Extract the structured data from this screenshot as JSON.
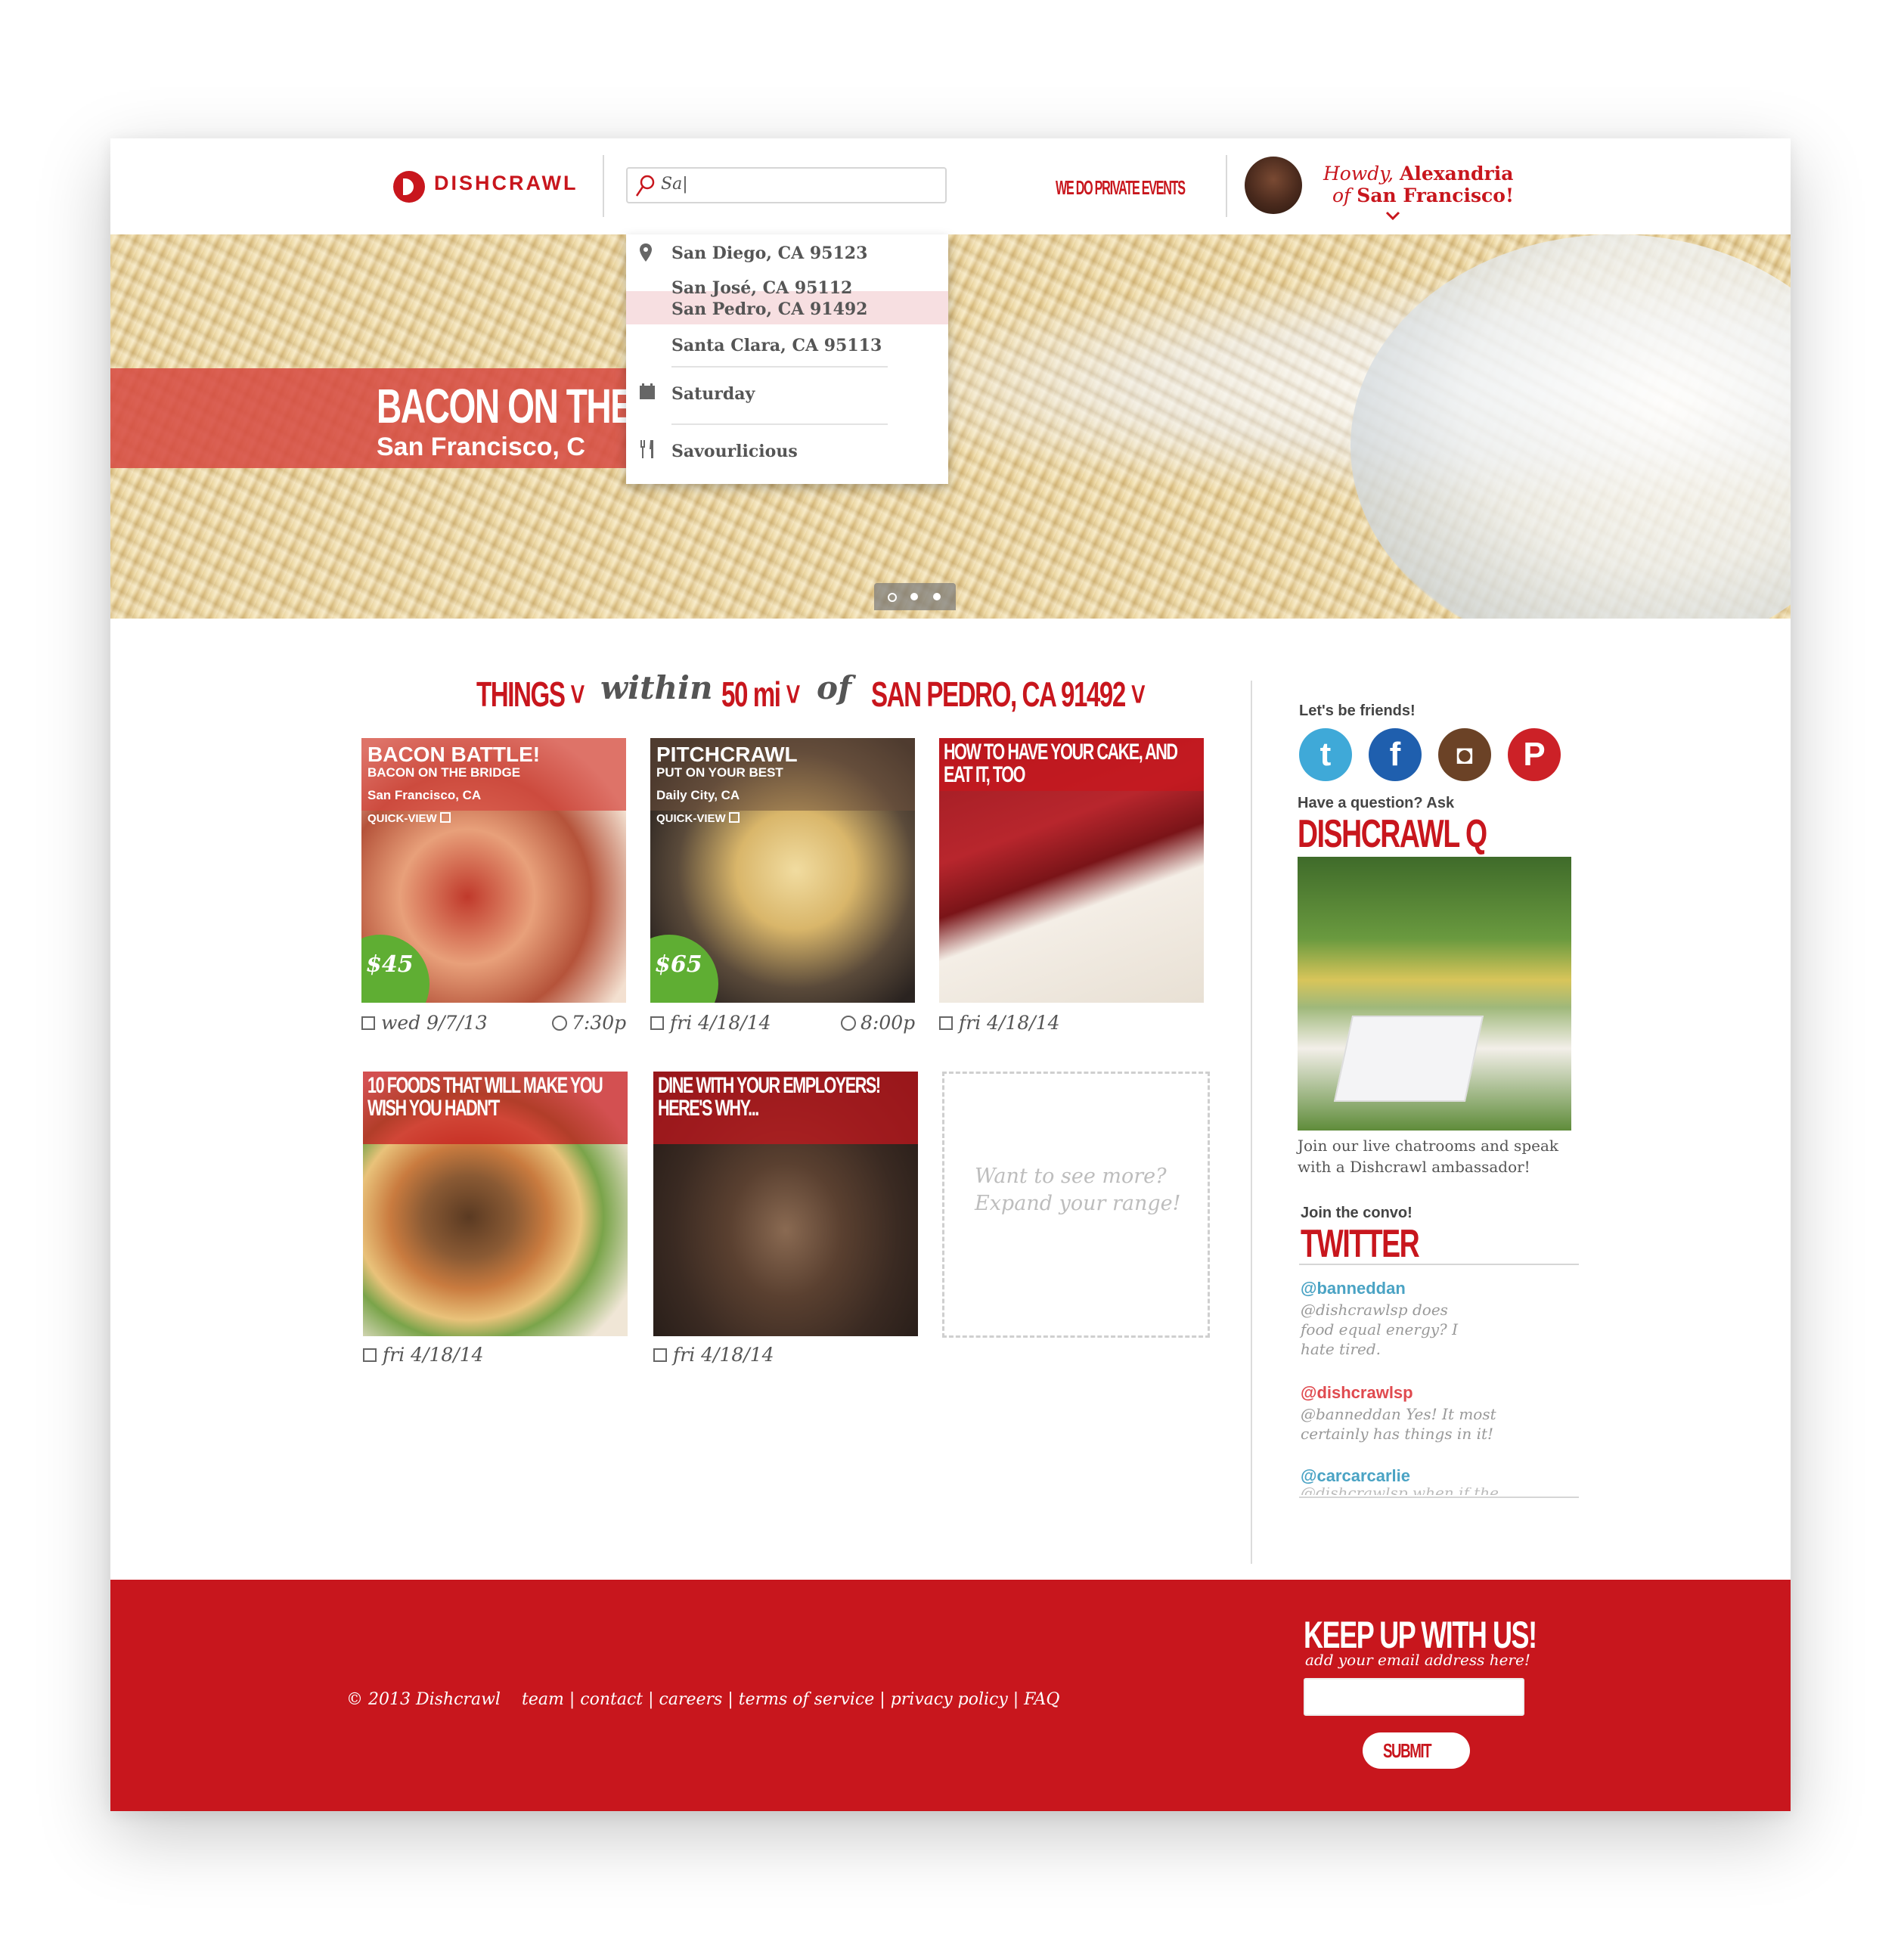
{
  "header": {
    "logo": "DISHCRAWL",
    "search_value": "Sa|",
    "private_events": "WE DO PRIVATE EVENTS",
    "greeting_howdy": "Howdy,",
    "greeting_name": "Alexandria",
    "greeting_of": "of",
    "greeting_city": "San Francisco!"
  },
  "dropdown": {
    "locations": [
      "San Diego, CA 95123",
      "San José, CA 95112",
      "San Pedro, CA 91492",
      "Santa Clara, CA 95113"
    ],
    "day": "Saturday",
    "category": "Savourlicious"
  },
  "hero": {
    "title": "BACON ON THE B",
    "subtitle": "San Francisco, C",
    "slides": 3,
    "active_slide": 1
  },
  "filter": {
    "things": "THINGS",
    "within": "within",
    "distance": "50 mi",
    "of": "of",
    "location": "SAN PEDRO, CA 91492"
  },
  "cards": [
    {
      "title": "BACON BATTLE!",
      "subtitle": "BACON ON THE BRIDGE",
      "city": "San Francisco, CA",
      "quickview": "QUICK-VIEW",
      "price": "$45",
      "date": "wed 9/7/13",
      "time": "7:30p"
    },
    {
      "title": "PITCHCRAWL",
      "subtitle": "PUT ON YOUR BEST",
      "city": "Daily City, CA",
      "quickview": "QUICK-VIEW",
      "price": "$65",
      "date": "fri 4/18/14",
      "time": "8:00p"
    },
    {
      "title": "HOW TO HAVE YOUR CAKE, AND EAT IT, TOO",
      "date": "fri 4/18/14"
    },
    {
      "title": "10 FOODS THAT WILL MAKE YOU WISH YOU HADN'T",
      "date": "fri 4/18/14"
    },
    {
      "title": "DINE WITH YOUR EMPLOYERS! HERE'S WHY...",
      "date": "fri 4/18/14"
    }
  ],
  "more": {
    "line1": "Want to see more?",
    "line2": "Expand your range!"
  },
  "sidebar": {
    "friends_head": "Let's be friends!",
    "social": [
      {
        "name": "twitter",
        "glyph": "t",
        "color": "#3fa9d8"
      },
      {
        "name": "facebook",
        "glyph": "f",
        "color": "#1f5fae"
      },
      {
        "name": "instagram",
        "glyph": "◘",
        "color": "#6b4226"
      },
      {
        "name": "pinterest",
        "glyph": "P",
        "color": "#cc2127"
      }
    ],
    "question_head": "Have a question? Ask",
    "q_title": "DISHCRAWL Q",
    "q_caption": "Join our live chatrooms and speak with a Dishcrawl ambassador!",
    "convo_head": "Join the convo!",
    "twitter_title": "TWITTER",
    "tweets": [
      {
        "handle": "@banneddan",
        "text": "@dishcrawlsp does food equal energy? I hate tired.",
        "color": "#4aa3c4"
      },
      {
        "handle": "@dishcrawlsp",
        "text": "@banneddan Yes! It most certainly has things in it!",
        "color": "#e04a4f"
      },
      {
        "handle": "@carcarcarlie",
        "text": "@dishcrawlsp when if the",
        "color": "#4aa3c4"
      }
    ]
  },
  "footer": {
    "copyright": "© 2013 Dishcrawl",
    "links": [
      "team",
      "contact",
      "careers",
      "terms of service",
      "privacy policy",
      "FAQ"
    ],
    "keep_up": "KEEP UP WITH US!",
    "email_hint": "add your email address here!",
    "submit": "SUBMIT"
  }
}
